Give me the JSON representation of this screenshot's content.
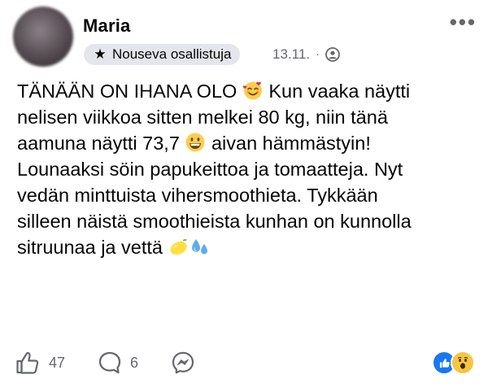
{
  "post": {
    "author": "Maria",
    "badge_label": "Nouseva osallistuja",
    "date": "13.11.",
    "separator": "·",
    "privacy_icon": "friends-icon",
    "more_label": "•••",
    "text_lines": [
      "TÄNÄÄN ON IHANA OLO",
      "Kun vaaka näytti",
      "nelisen viikkoa sitten melkei 80 kg, niin tänä",
      "aamuna näytti 73,7",
      "aivan hämmästyin!",
      "Lounaaksi söin papukeittoa ja tomaatteja. Nyt",
      "vedän minttuista vihersmoothieta. Tykkään",
      "silleen näistä smoothieista kunhan on kunnolla",
      "sitruunaa ja vettä"
    ],
    "emojis": [
      "smiling-face-with-hearts",
      "grinning-face",
      "lemon",
      "sweat-droplets"
    ]
  },
  "actions": {
    "like_count": "47",
    "comment_count": "6"
  },
  "reactions": [
    "like",
    "wow"
  ],
  "colors": {
    "text": "#050505",
    "secondary": "#65676b",
    "badge_bg": "#e4e6eb",
    "like_blue": "#1877f2",
    "wow_yellow": "#f7c443"
  }
}
